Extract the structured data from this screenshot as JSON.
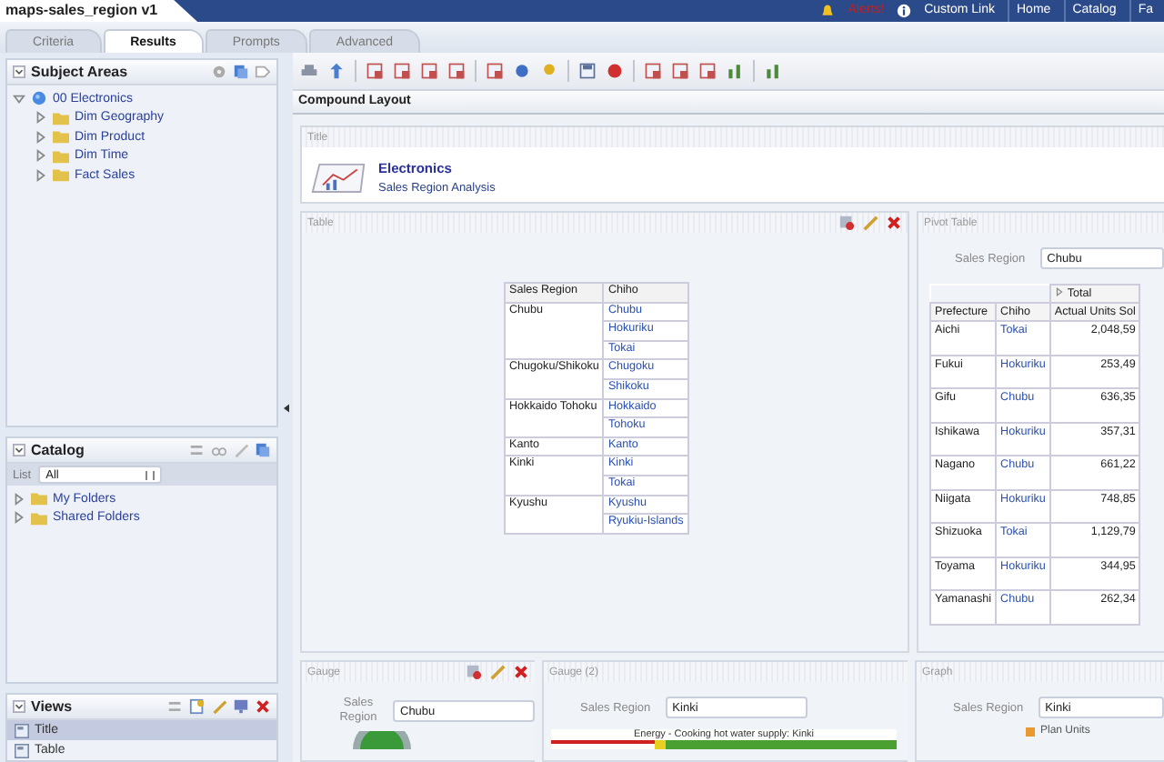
{
  "window": {
    "title": "maps-sales_region v1"
  },
  "header_links": [
    {
      "label": "Alerts!",
      "kind": "alert"
    },
    {
      "label": "Custom Link",
      "kind": "info"
    },
    {
      "label": "Home",
      "kind": "plain"
    },
    {
      "label": "Catalog",
      "kind": "plain"
    },
    {
      "label": "Fa",
      "kind": "plain"
    }
  ],
  "tabs": [
    {
      "label": "Criteria",
      "selected": false
    },
    {
      "label": "Results",
      "selected": true
    },
    {
      "label": "Prompts",
      "selected": false
    },
    {
      "label": "Advanced",
      "selected": false
    }
  ],
  "subject_areas": {
    "title": "Subject Areas",
    "tree": [
      {
        "label": "00 Electronics",
        "expanded": true,
        "children": [
          {
            "label": "Dim Geography",
            "expanded": false
          },
          {
            "label": "Dim Product",
            "expanded": false
          },
          {
            "label": "Dim Time",
            "expanded": false
          },
          {
            "label": "Fact Sales",
            "expanded": false
          }
        ]
      }
    ]
  },
  "catalog": {
    "title": "Catalog",
    "list_label": "List",
    "list_value": "All",
    "folders": [
      {
        "label": "My Folders",
        "expanded": false
      },
      {
        "label": "Shared Folders",
        "expanded": false
      }
    ]
  },
  "views": {
    "title": "Views",
    "items": [
      {
        "label": "Title",
        "selected": true
      },
      {
        "label": "Table",
        "selected": false
      }
    ]
  },
  "editor": {
    "title": "Compound Layout"
  },
  "title_view": {
    "label": "Title",
    "heading": "Electronics",
    "subtitle": "Sales Region Analysis"
  },
  "table_view": {
    "label": "Table",
    "columns": [
      "Sales Region",
      "Chiho"
    ],
    "groups": [
      {
        "region": "Chubu",
        "chiho": [
          "Chubu",
          "Hokuriku",
          "Tokai"
        ]
      },
      {
        "region": "Chugoku/Shikoku",
        "chiho": [
          "Chugoku",
          "Shikoku"
        ]
      },
      {
        "region": "Hokkaido Tohoku",
        "chiho": [
          "Hokkaido",
          "Tohoku"
        ]
      },
      {
        "region": "Kanto",
        "chiho": [
          "Kanto"
        ]
      },
      {
        "region": "Kinki",
        "chiho": [
          "Kinki",
          "Tokai"
        ]
      },
      {
        "region": "Kyushu",
        "chiho": [
          "Kyushu",
          "Ryukiu-Islands"
        ]
      }
    ]
  },
  "pivot_view": {
    "label": "Pivot Table",
    "prompt_label": "Sales Region",
    "prompt_value": "Chubu",
    "total_label": "Total",
    "columns": [
      "Prefecture",
      "Chiho",
      "Actual Units Sol"
    ],
    "rows": [
      [
        "Aichi",
        "Tokai",
        "2,048,59"
      ],
      [
        "Fukui",
        "Hokuriku",
        "253,49"
      ],
      [
        "Gifu",
        "Chubu",
        "636,35"
      ],
      [
        "Ishikawa",
        "Hokuriku",
        "357,31"
      ],
      [
        "Nagano",
        "Chubu",
        "661,22"
      ],
      [
        "Niigata",
        "Hokuriku",
        "748,85"
      ],
      [
        "Shizuoka",
        "Tokai",
        "1,129,79"
      ],
      [
        "Toyama",
        "Hokuriku",
        "344,95"
      ],
      [
        "Yamanashi",
        "Chubu",
        "262,34"
      ]
    ]
  },
  "gauges": [
    {
      "label": "Gauge",
      "prompt_label": "Sales Region",
      "prompt_value": "Chubu",
      "kind": "dial"
    },
    {
      "label": "Gauge (2)",
      "prompt_label": "Sales Region",
      "prompt_value": "Kinki",
      "kind": "bar",
      "caption": "Energy - Cooking hot water supply: Kinki"
    }
  ],
  "graph": {
    "label": "Graph",
    "prompt_label": "Sales Region",
    "prompt_value": "Kinki",
    "legend": "Plan Units"
  }
}
